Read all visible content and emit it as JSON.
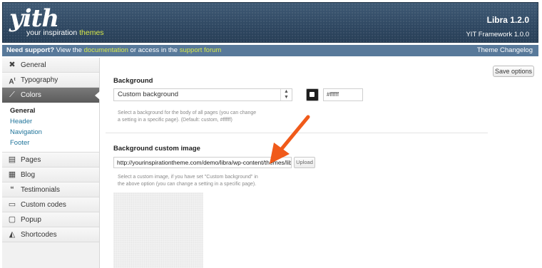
{
  "header": {
    "logo_word": "yith",
    "tagline_prefix": "your inspiration ",
    "tagline_accent": "themes",
    "version": "Libra 1.2.0",
    "framework": "YIT Framework 1.0.0"
  },
  "support": {
    "prefix": "Need support?",
    "text1": " View the ",
    "link1": "documentation",
    "text2": " or access in the ",
    "link2": "support forum",
    "changelog": "Theme Changelog"
  },
  "sidebar": {
    "items": [
      {
        "label": "General",
        "icon": "wrench-icon"
      },
      {
        "label": "Typography",
        "icon": "typography-icon"
      },
      {
        "label": "Colors",
        "icon": "brush-icon"
      },
      {
        "label": "Pages",
        "icon": "pages-icon"
      },
      {
        "label": "Blog",
        "icon": "blog-icon"
      },
      {
        "label": "Testimonials",
        "icon": "quote-icon"
      },
      {
        "label": "Custom codes",
        "icon": "code-icon"
      },
      {
        "label": "Popup",
        "icon": "popup-icon"
      },
      {
        "label": "Shortcodes",
        "icon": "shortcodes-icon"
      }
    ],
    "active": "Colors",
    "subitems": [
      "General",
      "Header",
      "Navigation",
      "Footer"
    ],
    "active_sub": "General"
  },
  "main": {
    "save_label": "Save options",
    "background": {
      "label": "Background",
      "select_value": "Custom background",
      "color_value": "#ffffff",
      "desc_line1": "Select a background for the body of all pages (you can change",
      "desc_line2": "a setting in a specific page). (Default: custom, #ffffff)"
    },
    "custom_image": {
      "label": "Background custom image",
      "url_value": "http://yourinspirationtheme.com/demo/libra/wp-content/themes/libra/images",
      "upload_label": "Upload",
      "desc_line1": "Select a custom image, if you have set \"Custom background\" in",
      "desc_line2": "the above option (you can change a setting in a specific page)."
    }
  },
  "colors": {
    "header_bg": "#2f4862",
    "support_bg": "#58799a",
    "accent": "#d7e84a",
    "link": "#21759b",
    "arrow": "#f05a1a"
  }
}
